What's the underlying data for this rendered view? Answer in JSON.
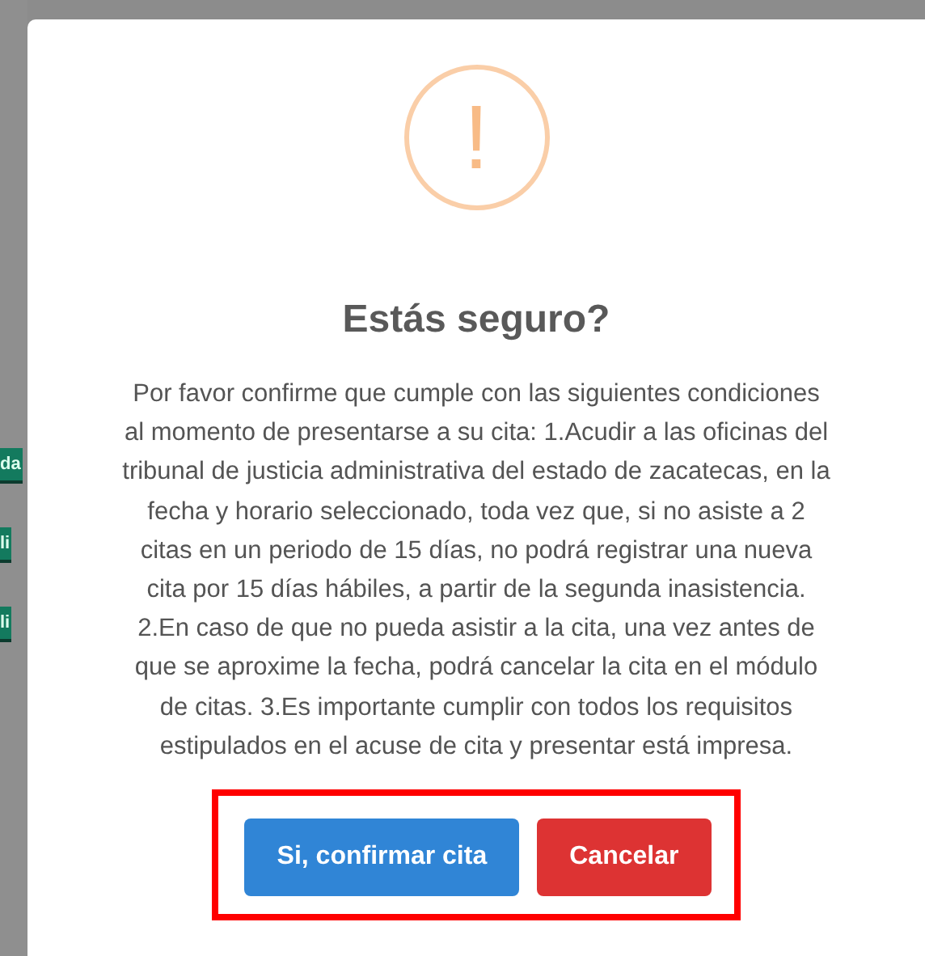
{
  "background": {
    "buttons": [
      "da",
      "li",
      "li"
    ]
  },
  "dialog": {
    "icon": "!",
    "title": "Estás seguro?",
    "message": "Por favor confirme que cumple con las siguientes condiciones al momento de presentarse a su cita: 1.Acudir a las oficinas del tribunal de justicia administrativa del estado de zacatecas, en la fecha y horario seleccionado, toda vez que, si no asiste a 2 citas en un periodo de 15 días, no podrá registrar una nueva cita por 15 días hábiles, a partir de la segunda inasistencia. 2.En caso de que no pueda asistir a la cita, una vez antes de que se aproxime la fecha, podrá cancelar la cita en el módulo de citas. 3.Es importante cumplir con todos los requisitos estipulados en el acuse de cita y presentar está impresa.",
    "buttons": [
      {
        "kind": "confirm",
        "label": "Si, confirmar cita"
      },
      {
        "kind": "cancel",
        "label": "Cancelar"
      }
    ],
    "highlighted": true
  }
}
